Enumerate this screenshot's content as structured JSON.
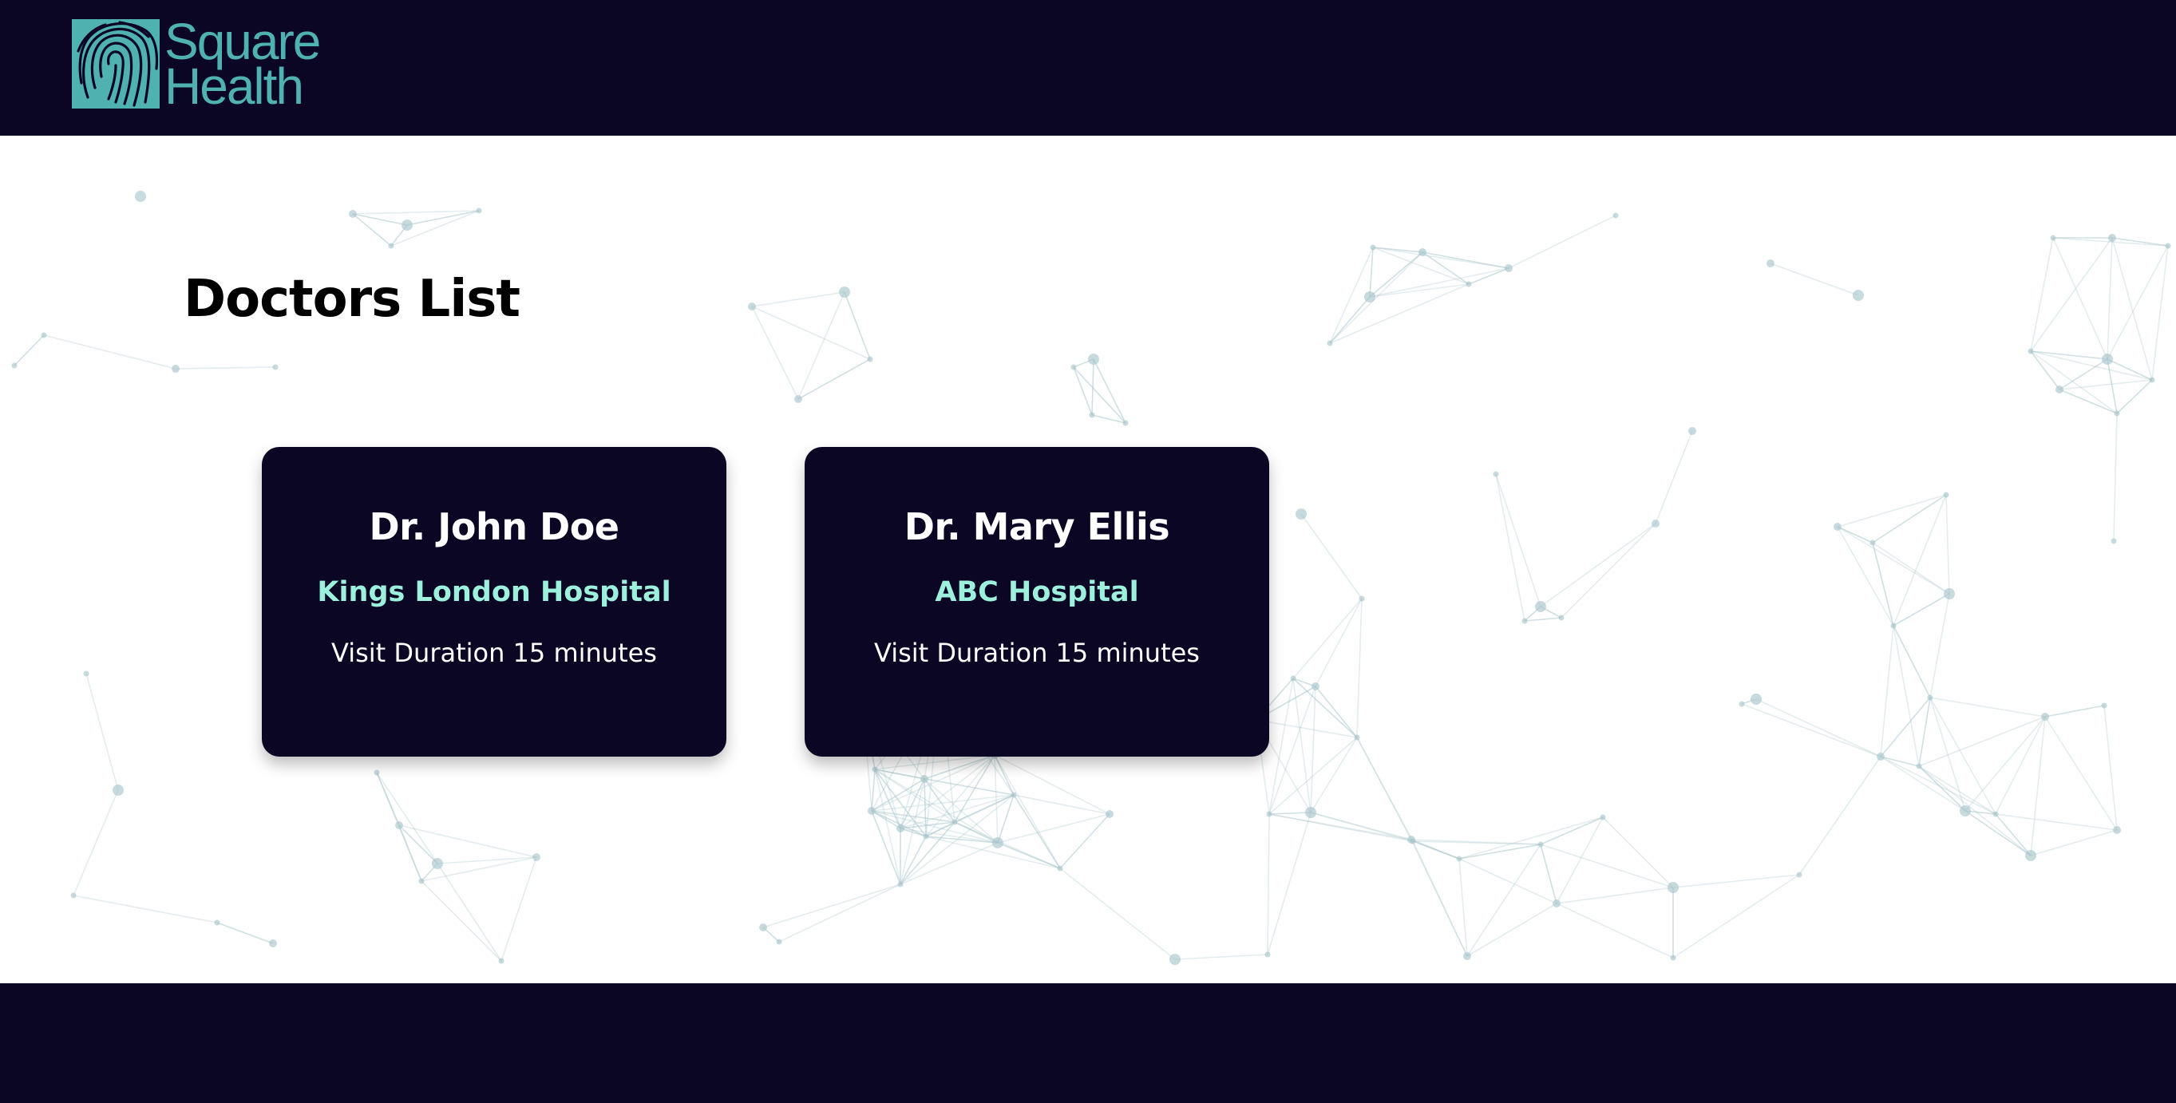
{
  "header": {
    "logo": {
      "line1": "Square",
      "line2": "Health",
      "icon": "fingerprint-icon"
    }
  },
  "main": {
    "title": "Doctors List",
    "doctors": [
      {
        "name": "Dr. John Doe",
        "hospital": "Kings London Hospital",
        "duration": "Visit Duration 15 minutes"
      },
      {
        "name": "Dr. Mary Ellis",
        "hospital": "ABC Hospital",
        "duration": "Visit Duration 15 minutes"
      }
    ]
  },
  "colors": {
    "navy": "#0a0624",
    "logo_teal": "#4fb2b0",
    "hospital_mint": "#9cf0dc",
    "network_node": "#a9c6cd",
    "background": "#ffffff"
  }
}
